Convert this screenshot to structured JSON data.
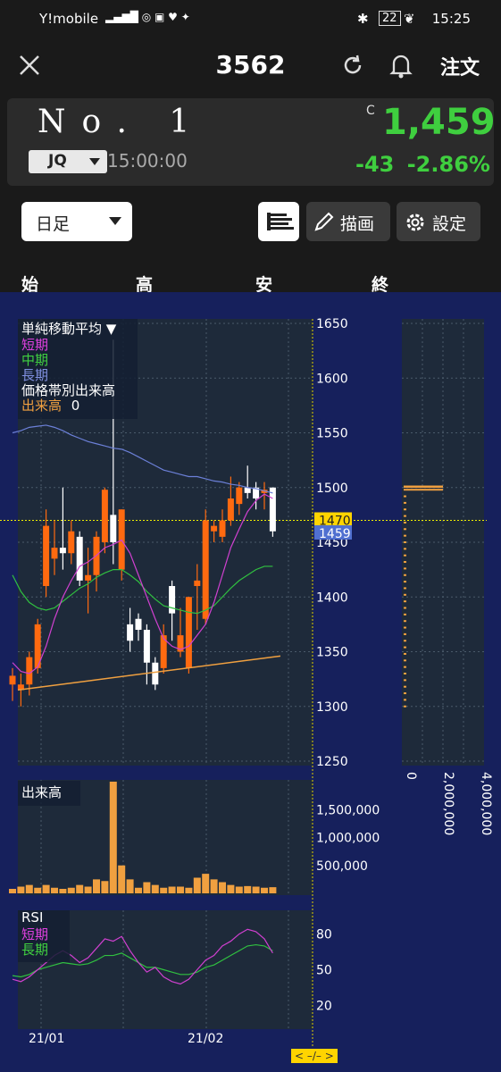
{
  "status_bar": {
    "carrier": "Y!mobile",
    "battery": "22",
    "time": "15:25"
  },
  "header": {
    "title": "3562",
    "order_label": "注文"
  },
  "quote": {
    "name": "No. 1",
    "market": "JQ",
    "time": "15:00:00",
    "c_mark": "C",
    "price": "1,459",
    "change": "-43",
    "change_pct": "-2.86%",
    "up_color": "#3fcf3f"
  },
  "controls": {
    "period": "日足",
    "draw_label": "描画",
    "settings_label": "設定"
  },
  "ohlc_headers": [
    "始",
    "高",
    "安",
    "終"
  ],
  "legend": {
    "title": "単純移動平均 ▼",
    "short": "短期",
    "mid": "中期",
    "long": "長期",
    "volume_profile": "価格帯別出来高",
    "volume_label": "出来高",
    "volume_value": "0"
  },
  "volume_panel_label": "出来高",
  "rsi_panel": {
    "title": "RSI",
    "short": "短期",
    "long": "長期"
  },
  "scroll_indicator": "< –/– >",
  "chart_data": [
    {
      "type": "candlestick",
      "price_ticks": [
        "1650",
        "1600",
        "1550",
        "1500",
        "1450",
        "1400",
        "1350",
        "1300",
        "1250"
      ],
      "ylim": [
        1250,
        1650
      ],
      "x_tick_labels": [
        "21/01",
        "21/02"
      ],
      "current_price_marker": "1470",
      "last_price_marker": "1459",
      "candles": [
        {
          "o": 1320,
          "h": 1335,
          "l": 1305,
          "c": 1328
        },
        {
          "o": 1315,
          "h": 1330,
          "l": 1300,
          "c": 1320
        },
        {
          "o": 1320,
          "h": 1350,
          "l": 1310,
          "c": 1345
        },
        {
          "o": 1335,
          "h": 1380,
          "l": 1330,
          "c": 1375
        },
        {
          "o": 1410,
          "h": 1480,
          "l": 1400,
          "c": 1465
        },
        {
          "o": 1435,
          "h": 1470,
          "l": 1420,
          "c": 1445
        },
        {
          "o": 1445,
          "h": 1500,
          "l": 1425,
          "c": 1440
        },
        {
          "o": 1440,
          "h": 1470,
          "l": 1430,
          "c": 1460
        },
        {
          "o": 1455,
          "h": 1460,
          "l": 1410,
          "c": 1415
        },
        {
          "o": 1415,
          "h": 1445,
          "l": 1385,
          "c": 1420
        },
        {
          "o": 1420,
          "h": 1460,
          "l": 1405,
          "c": 1455
        },
        {
          "o": 1450,
          "h": 1500,
          "l": 1440,
          "c": 1498
        },
        {
          "o": 1475,
          "h": 1635,
          "l": 1430,
          "c": 1450
        },
        {
          "o": 1425,
          "h": 1480,
          "l": 1415,
          "c": 1480
        },
        {
          "o": 1375,
          "h": 1390,
          "l": 1350,
          "c": 1360
        },
        {
          "o": 1380,
          "h": 1385,
          "l": 1360,
          "c": 1370
        },
        {
          "o": 1370,
          "h": 1375,
          "l": 1320,
          "c": 1340
        },
        {
          "o": 1340,
          "h": 1345,
          "l": 1315,
          "c": 1320
        },
        {
          "o": 1335,
          "h": 1375,
          "l": 1330,
          "c": 1365
        },
        {
          "o": 1410,
          "h": 1415,
          "l": 1360,
          "c": 1385
        },
        {
          "o": 1350,
          "h": 1390,
          "l": 1345,
          "c": 1365
        },
        {
          "o": 1335,
          "h": 1400,
          "l": 1330,
          "c": 1400
        },
        {
          "o": 1410,
          "h": 1430,
          "l": 1370,
          "c": 1415
        },
        {
          "o": 1380,
          "h": 1480,
          "l": 1375,
          "c": 1470
        },
        {
          "o": 1460,
          "h": 1470,
          "l": 1450,
          "c": 1465
        },
        {
          "o": 1455,
          "h": 1480,
          "l": 1450,
          "c": 1470
        },
        {
          "o": 1470,
          "h": 1510,
          "l": 1465,
          "c": 1490
        },
        {
          "o": 1485,
          "h": 1505,
          "l": 1475,
          "c": 1500
        },
        {
          "o": 1500,
          "h": 1520,
          "l": 1490,
          "c": 1495
        },
        {
          "o": 1500,
          "h": 1505,
          "l": 1480,
          "c": 1490
        },
        {
          "o": 1495,
          "h": 1505,
          "l": 1480,
          "c": 1498
        },
        {
          "o": 1500,
          "h": 1500,
          "l": 1455,
          "c": 1460
        }
      ],
      "ma_short": [
        1340,
        1332,
        1330,
        1336,
        1355,
        1380,
        1400,
        1415,
        1428,
        1432,
        1438,
        1445,
        1448,
        1452,
        1440,
        1420,
        1400,
        1380,
        1362,
        1355,
        1352,
        1355,
        1365,
        1375,
        1395,
        1420,
        1445,
        1462,
        1478,
        1488,
        1494,
        1490
      ],
      "ma_mid": [
        1420,
        1405,
        1395,
        1390,
        1388,
        1390,
        1396,
        1402,
        1408,
        1412,
        1418,
        1422,
        1425,
        1425,
        1420,
        1414,
        1405,
        1398,
        1392,
        1390,
        1388,
        1386,
        1385,
        1388,
        1392,
        1400,
        1408,
        1415,
        1420,
        1425,
        1428,
        1428
      ],
      "ma_long": [
        1550,
        1552,
        1555,
        1556,
        1557,
        1555,
        1552,
        1548,
        1545,
        1542,
        1540,
        1538,
        1536,
        1535,
        1532,
        1528,
        1524,
        1520,
        1516,
        1514,
        1512,
        1510,
        1510,
        1508,
        1506,
        1505,
        1503,
        1502,
        1500,
        1499,
        1497,
        1495
      ],
      "trendline": {
        "from": 1315,
        "to": 1346
      }
    },
    {
      "type": "bar",
      "name": "出来高",
      "y_ticks": [
        "1,500,000",
        "1,000,000",
        "500,000"
      ],
      "values": [
        80000,
        120000,
        150000,
        100000,
        150000,
        100000,
        80000,
        100000,
        150000,
        120000,
        250000,
        220000,
        2000000,
        500000,
        250000,
        100000,
        200000,
        150000,
        100000,
        120000,
        120000,
        100000,
        280000,
        350000,
        250000,
        200000,
        150000,
        120000,
        130000,
        120000,
        100000,
        110000
      ]
    },
    {
      "type": "line",
      "name": "RSI",
      "y_ticks": [
        "80",
        "50",
        "20"
      ],
      "ylim": [
        0,
        100
      ],
      "short": [
        42,
        40,
        44,
        50,
        56,
        62,
        66,
        62,
        56,
        60,
        68,
        76,
        74,
        78,
        66,
        56,
        48,
        52,
        44,
        40,
        38,
        42,
        50,
        58,
        62,
        70,
        74,
        80,
        84,
        82,
        76,
        64
      ],
      "long": [
        45,
        44,
        46,
        50,
        52,
        54,
        56,
        55,
        54,
        55,
        58,
        62,
        62,
        64,
        60,
        56,
        52,
        52,
        50,
        48,
        46,
        46,
        48,
        52,
        54,
        58,
        62,
        66,
        70,
        71,
        70,
        66
      ]
    },
    {
      "type": "bar",
      "name": "価格帯別出来高",
      "orientation": "horizontal",
      "x_ticks": [
        "0",
        "2,000,000",
        "4,000,000"
      ]
    }
  ]
}
